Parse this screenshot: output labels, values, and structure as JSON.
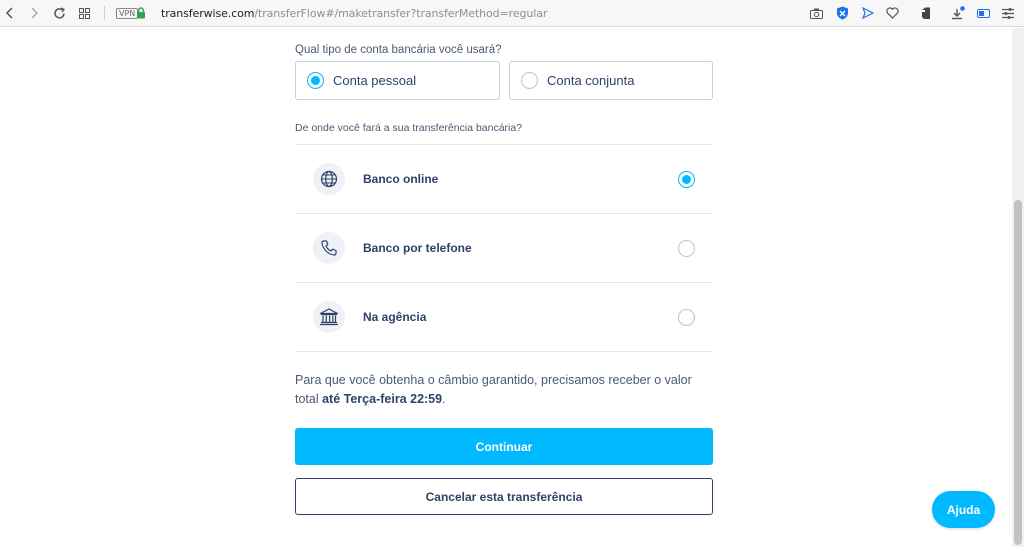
{
  "browser": {
    "vpn_label": "VPN",
    "url_host": "transferwise.com",
    "url_path": "/transferFlow#/maketransfer?transferMethod=regular",
    "colors": {
      "lock": "#2ea44f",
      "accent": "#1a73e8"
    },
    "icons": [
      "back-icon",
      "forward-icon",
      "reload-icon",
      "grid-icon",
      "lock-icon",
      "camera-icon",
      "shield-icon",
      "send-icon",
      "heart-icon",
      "evernote-icon",
      "download-icon",
      "battery-icon",
      "menu-icon"
    ]
  },
  "account_type": {
    "question": "Qual tipo de conta bancária você usará?",
    "options": [
      {
        "label": "Conta pessoal",
        "selected": true
      },
      {
        "label": "Conta conjunta",
        "selected": false
      }
    ]
  },
  "transfer_method": {
    "question": "De onde você fará a sua transferência bancária?",
    "options": [
      {
        "label": "Banco online",
        "icon": "globe-icon",
        "selected": true
      },
      {
        "label": "Banco por telefone",
        "icon": "phone-icon",
        "selected": false
      },
      {
        "label": "Na agência",
        "icon": "bank-icon",
        "selected": false
      }
    ]
  },
  "note": {
    "text": "Para que você obtenha o câmbio garantido, precisamos receber o valor total ",
    "deadline": "até Terça-feira 22:59",
    "end": "."
  },
  "actions": {
    "continue_label": "Continuar",
    "cancel_label": "Cancelar esta transferência"
  },
  "help": {
    "label": "Ajuda"
  },
  "colors": {
    "accent": "#00b9ff",
    "text": "#2e4369",
    "border": "#c9d2de"
  }
}
